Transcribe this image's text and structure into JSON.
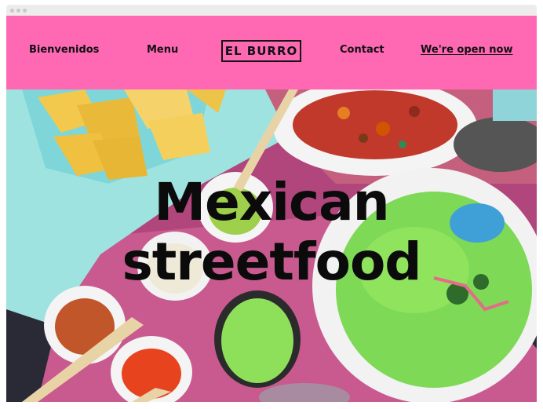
{
  "nav": {
    "welcome": "Bienvenidos",
    "menu": "Menu",
    "logo": "EL BURRO",
    "contact": "Contact",
    "open_now": "We're open now"
  },
  "hero": {
    "headline_line1": "Mexican",
    "headline_line2": "streetfood"
  },
  "colors": {
    "nav_background": "#ff69b4",
    "text": "#111111"
  }
}
